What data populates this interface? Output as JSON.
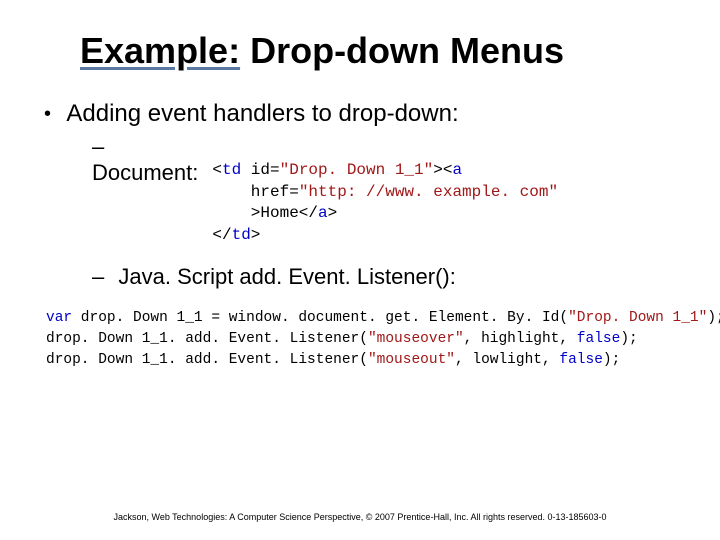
{
  "title": {
    "underlined": "Example:",
    "rest": " Drop-down Menus"
  },
  "main_bullet": "Adding event handlers to drop-down:",
  "sub1": {
    "label": "Document:",
    "code_html": "&lt;<span class=\"kw\">td</span> id=<span class=\"str\">\"Drop. Down 1_1\"</span>&gt;&lt;<span class=\"kw\">a</span>\n    href=<span class=\"str\">\"http: //www. example. com\"</span>\n    &gt;Home&lt;/<span class=\"kw\">a</span>&gt;\n&lt;/<span class=\"kw\">td</span>&gt;"
  },
  "sub2": {
    "prefix": "Java. Script ",
    "method": "add. Event. Listener()",
    "suffix": ":",
    "code_html": "<span class=\"kw\">var</span> drop. Down 1_1 = window. document. get. Element. By. Id(<span class=\"str\">\"Drop. Down 1_1\"</span>);\ndrop. Down 1_1. add. Event. Listener(<span class=\"str\">\"mouseover\"</span>, highlight, <span class=\"kw\">false</span>);\ndrop. Down 1_1. add. Event. Listener(<span class=\"str\">\"mouseout\"</span>, lowlight, <span class=\"kw\">false</span>);"
  },
  "footer": "Jackson, Web Technologies: A Computer Science Perspective, © 2007 Prentice-Hall, Inc. All rights reserved. 0-13-185603-0"
}
